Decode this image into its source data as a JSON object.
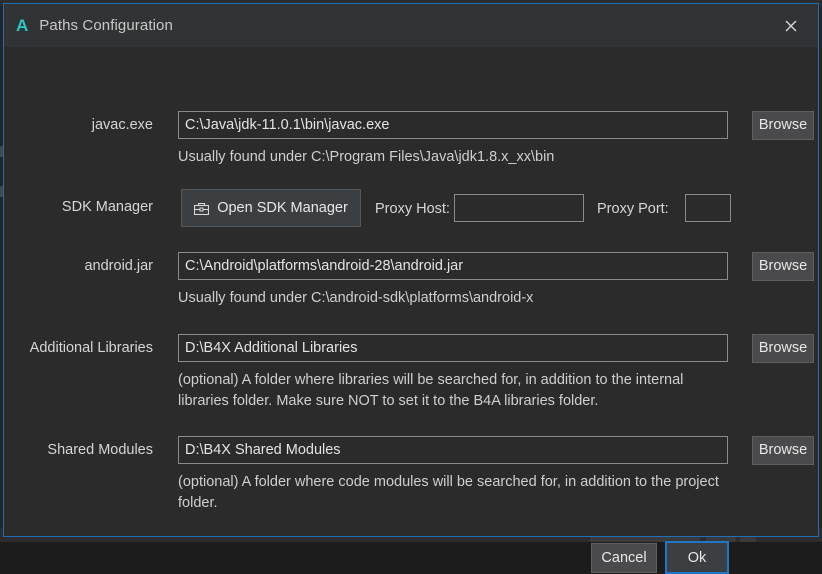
{
  "window": {
    "title": "Paths Configuration",
    "logo_letter": "A",
    "close_icon": "close-icon",
    "accent_border": "#1d6fb8",
    "logo_color": "#2cc5c5"
  },
  "rows": {
    "javac": {
      "label": "javac.exe",
      "value": "C:\\Java\\jdk-11.0.1\\bin\\javac.exe",
      "hint": "Usually found under C:\\Program Files\\Java\\jdk1.8.x_xx\\bin",
      "browse_label": "Browse"
    },
    "sdk_manager": {
      "label": "SDK Manager",
      "button_label": "Open SDK Manager",
      "button_icon": "toolbox-icon",
      "proxy_host_label": "Proxy Host:",
      "proxy_host_value": "",
      "proxy_port_label": "Proxy Port:",
      "proxy_port_value": ""
    },
    "android_jar": {
      "label": "android.jar",
      "value": "C:\\Android\\platforms\\android-28\\android.jar",
      "hint": "Usually found under C:\\android-sdk\\platforms\\android-x",
      "browse_label": "Browse"
    },
    "additional_libraries": {
      "label": "Additional Libraries",
      "value": "D:\\B4X Additional Libraries",
      "hint": "(optional) A folder where libraries will be searched for, in addition to the internal libraries folder. Make sure NOT to set it to the B4A libraries folder.",
      "browse_label": "Browse"
    },
    "shared_modules": {
      "label": "Shared Modules",
      "value": "D:\\B4X Shared Modules",
      "hint": "(optional) A folder where code modules will be searched for, in addition to the project folder.",
      "browse_label": "Browse"
    }
  },
  "footer": {
    "cancel_label": "Cancel",
    "ok_label": "Ok",
    "ok_focus_color": "#2175c8"
  }
}
